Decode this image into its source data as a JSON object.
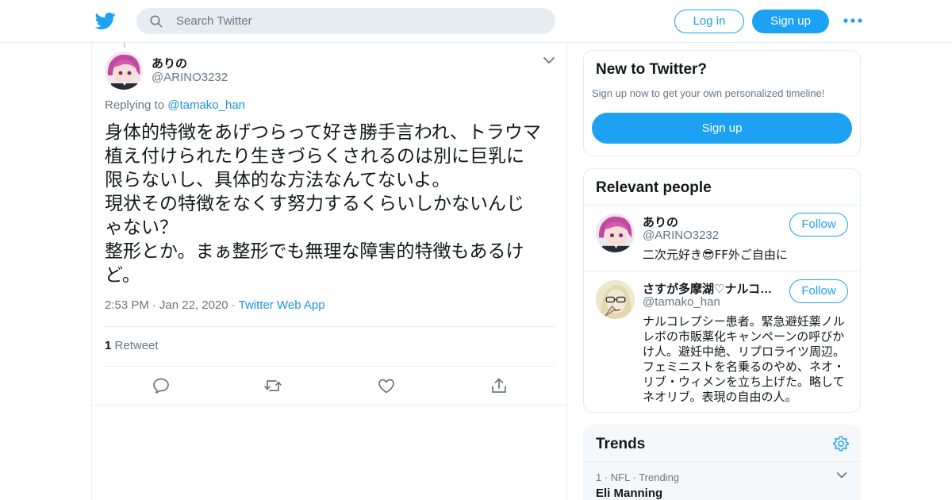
{
  "header": {
    "search_placeholder": "Search Twitter",
    "login_label": "Log in",
    "signup_label": "Sign up",
    "brand_color": "#1da1f2"
  },
  "tweet": {
    "author_name": "ありの",
    "author_handle": "@ARINO3232",
    "replying_prefix": "Replying to",
    "replying_to": "@tamako_han",
    "text": "身体的特徴をあげつらって好き勝手言われ、トラウマ\n植え付けられたり生きづらくされるのは別に巨乳に\n限らないし、具体的な方法なんてないよ。\n現状その特徴をなくす努力するくらいしかないんじ\nゃない？\n整形とか。まぁ整形でも無理な障害的特徴もあるけ\nど。",
    "time": "2:53 PM",
    "date": "Jan 22, 2020",
    "app": "Twitter Web App",
    "retweet_count": "1",
    "retweet_label": "Retweet"
  },
  "sidebar": {
    "new_to_twitter": {
      "title": "New to Twitter?",
      "subtitle": "Sign up now to get your own personalized timeline!",
      "button_label": "Sign up"
    },
    "relevant_people": {
      "title": "Relevant people",
      "people": [
        {
          "name": "ありの",
          "handle": "@ARINO3232",
          "bio": "二次元好き😎FF外ご自由に",
          "follow_label": "Follow"
        },
        {
          "name": "さすが多摩湖♡ナルコレプシー",
          "handle": "@tamako_han",
          "bio": "ナルコレプシー患者。緊急避妊薬ノルレボの市販薬化キャンペーンの呼びかけ人。避妊中絶、リプロライツ周辺。フェミニストを名乗るのやめ、ネオ・リブ・ウィメンを立ち上げた。略してネオリブ。表現の自由の人。",
          "follow_label": "Follow"
        }
      ]
    },
    "trends": {
      "title": "Trends",
      "items": [
        {
          "rank": "1",
          "category": "NFL",
          "status": "Trending",
          "name": "Eli Manning"
        }
      ]
    }
  }
}
